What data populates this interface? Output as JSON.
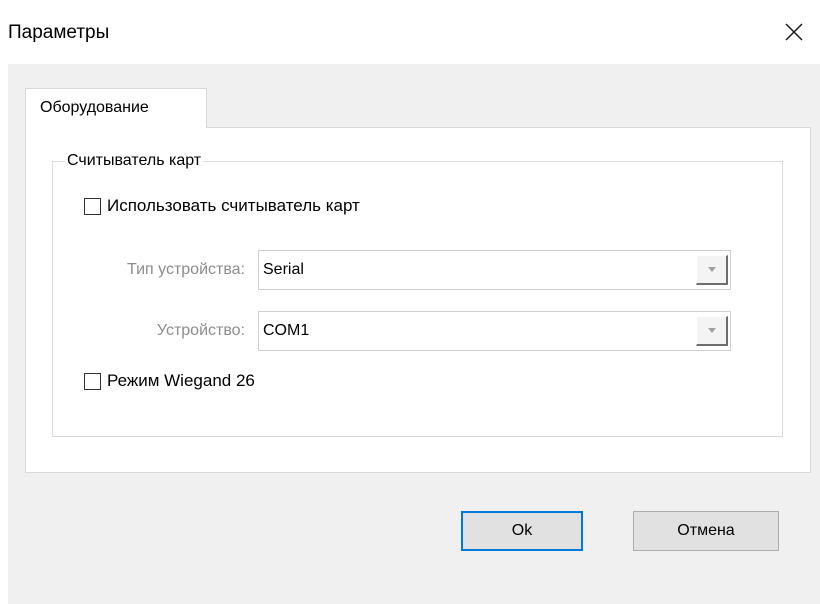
{
  "window": {
    "title": "Параметры"
  },
  "tabs": [
    {
      "label": "Оборудование",
      "selected": true
    }
  ],
  "card_reader_group": {
    "title": "Считыватель карт",
    "use_reader": {
      "label": "Использовать считыватель карт",
      "checked": false
    },
    "device_type": {
      "label": "Тип устройства:",
      "value": "Serial",
      "enabled": false
    },
    "device": {
      "label": "Устройство:",
      "value": "COM1",
      "enabled": false
    },
    "wiegand_mode": {
      "label": "Режим Wiegand 26",
      "checked": false
    }
  },
  "buttons": {
    "ok_label": "Ok",
    "cancel_label": "Отмена"
  },
  "colors": {
    "accent": "#0078d7",
    "disabled_text": "#8c8c8c",
    "dialog_background": "#f0f0f0"
  },
  "icons": {
    "close": "close-icon",
    "dropdown": "chevron-down-icon"
  }
}
